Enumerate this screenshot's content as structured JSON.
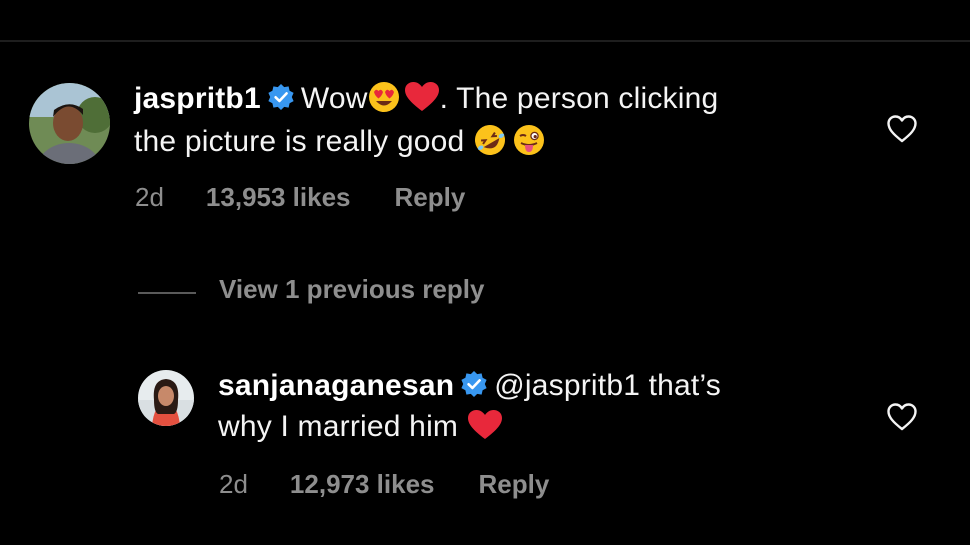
{
  "comments": [
    {
      "username": "jaspritb1",
      "text_line1": "Wow",
      "emojis_line1": [
        "heart-eyes-emoji",
        "red-heart-emoji"
      ],
      "text_line1_after": ". The person clicking",
      "text_line2": "the picture is really good",
      "emojis_line2": [
        "rolling-laughing-emoji",
        "winking-tongue-emoji"
      ],
      "time": "2d",
      "likes": "13,953 likes",
      "reply_label": "Reply"
    },
    {
      "username": "sanjanaganesan",
      "mention": "@jaspritb1 that’s",
      "text_line2": "why I married him",
      "emojis_line2": [
        "red-heart-emoji"
      ],
      "time": "2d",
      "likes": "12,973 likes",
      "reply_label": "Reply"
    }
  ],
  "view_replies_label": "View 1 previous reply",
  "colors": {
    "background": "#000000",
    "text": "#f4f4f4",
    "muted": "#8e8e8e",
    "verified": "#3897f0",
    "heart": "#e8283b"
  }
}
